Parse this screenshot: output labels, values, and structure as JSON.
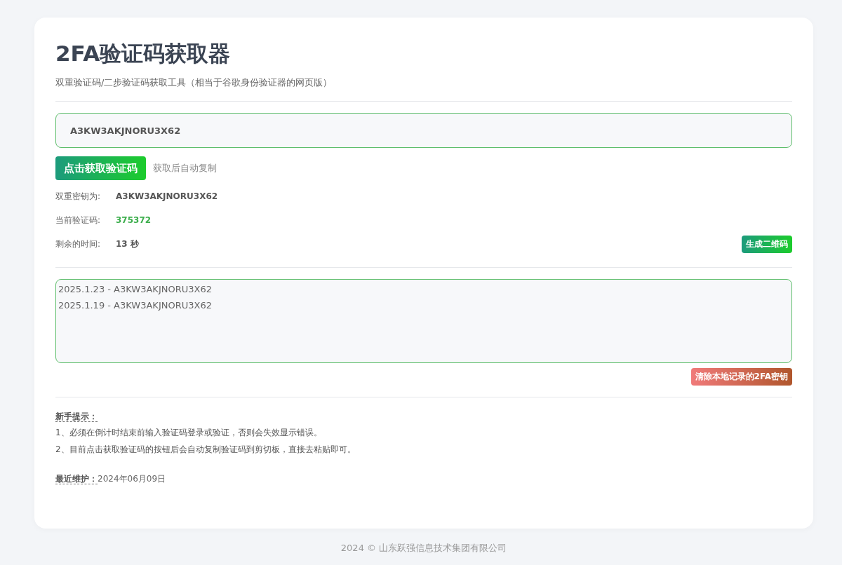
{
  "title": "2FA验证码获取器",
  "subtitle": "双重验证码/二步验证码获取工具（相当于谷歌身份验证器的网页版）",
  "secret_input": {
    "value": "A3KW3AKJNORU3X62"
  },
  "get_code_button": "点击获取验证码",
  "get_code_hint": "获取后自动复制",
  "info_rows": [
    {
      "label": "双重密钥为:",
      "value": "A3KW3AKJNORU3X62",
      "kind": "secret"
    },
    {
      "label": "当前验证码:",
      "value": "375372",
      "kind": "code"
    },
    {
      "label": "剩余的时间:",
      "value": "13",
      "unit": "秒",
      "kind": "timer"
    }
  ],
  "qr_button": "生成二维码",
  "history": [
    "2025.1.23 - A3KW3AKJNORU3X62",
    "2025.1.19 - A3KW3AKJNORU3X62"
  ],
  "clear_button": "清除本地记录的2FA密钥",
  "tips": {
    "heading": "新手提示：",
    "items": [
      "1、必须在倒计时结束前输入验证码登录或验证，否则会失效显示错误。",
      "2、目前点击获取验证码的按钮后会自动复制验证码到剪切板，直接去粘贴即可。"
    ]
  },
  "maintenance": {
    "label": "最近维护：",
    "date": "2024年06月09日"
  },
  "footer": "2024 © 山东跃强信息技术集团有限公司"
}
